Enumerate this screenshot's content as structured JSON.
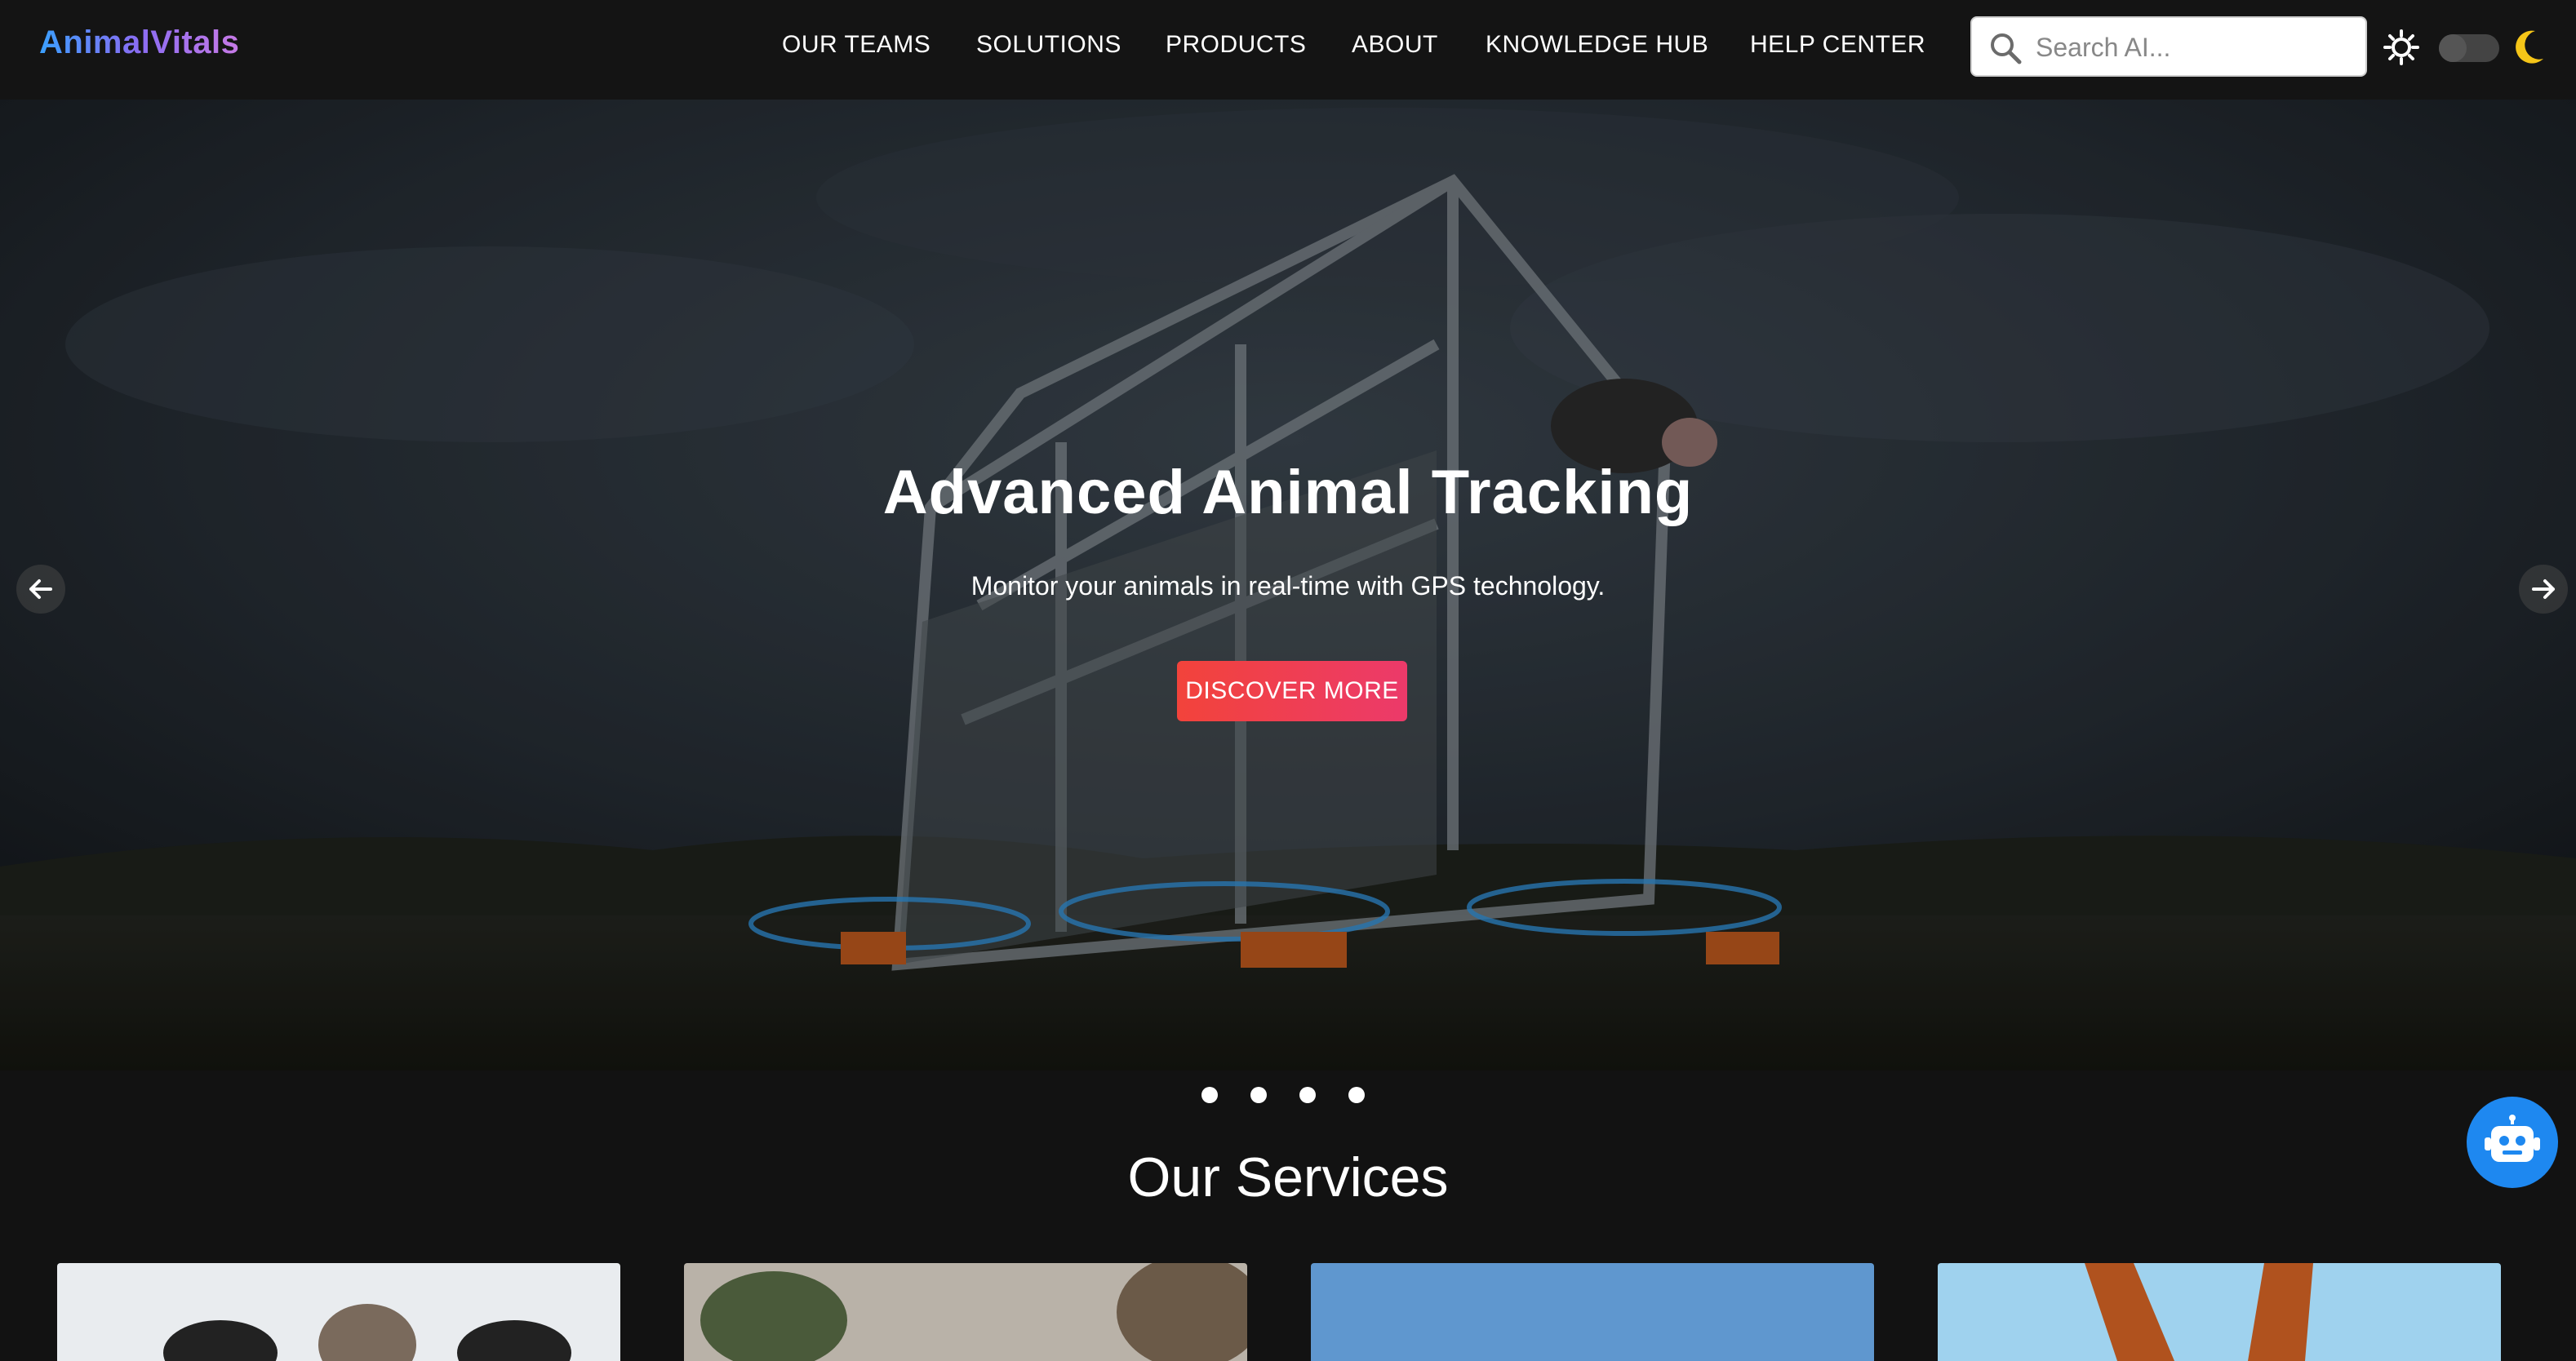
{
  "header": {
    "logo": "AnimalVitals",
    "nav": [
      "OUR TEAMS",
      "SOLUTIONS",
      "PRODUCTS",
      "ABOUT",
      "KNOWLEDGE HUB",
      "HELP CENTER"
    ],
    "search_placeholder": "Search AI..."
  },
  "hero": {
    "title": "Advanced Animal Tracking",
    "subtitle": "Monitor your animals in real-time with GPS technology.",
    "cta": "DISCOVER MORE",
    "slide_count": 4
  },
  "services": {
    "title": "Our Services"
  },
  "colors": {
    "background": "#121212",
    "cta_start": "#f2433b",
    "cta_end": "#ec3a6a",
    "chatbot": "#1e88f0",
    "moon": "#f5c518"
  }
}
